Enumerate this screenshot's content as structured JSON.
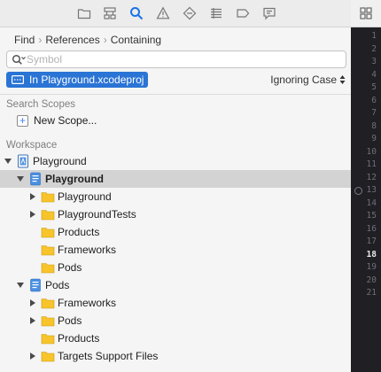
{
  "toolbar": {
    "icons": [
      "folder-icon",
      "hierarchy-icon",
      "search-icon",
      "warning-icon",
      "diamond-icon",
      "list-icon",
      "tag-icon",
      "comment-icon"
    ],
    "active": "search-icon"
  },
  "breadcrumb": [
    "Find",
    "References",
    "Containing"
  ],
  "search": {
    "placeholder": "Symbol",
    "value": ""
  },
  "scope_chip": {
    "label": "In Playground.xcodeproj"
  },
  "case_select": {
    "label": "Ignoring Case"
  },
  "search_scopes": {
    "title": "Search Scopes",
    "new_scope_label": "New Scope..."
  },
  "workspace": {
    "title": "Workspace",
    "rows": [
      {
        "label": "Playground",
        "icon": "workspace-icon",
        "disclosure": "expanded",
        "selected": false,
        "bold": false
      },
      {
        "label": "Playground",
        "icon": "project-icon",
        "disclosure": "expanded",
        "selected": true,
        "bold": true
      },
      {
        "label": "Playground",
        "icon": "folder-icon",
        "disclosure": "collapsed",
        "selected": false,
        "bold": false
      },
      {
        "label": "PlaygroundTests",
        "icon": "folder-icon",
        "disclosure": "collapsed",
        "selected": false,
        "bold": false
      },
      {
        "label": "Products",
        "icon": "folder-icon",
        "disclosure": "none",
        "selected": false,
        "bold": false
      },
      {
        "label": "Frameworks",
        "icon": "folder-icon",
        "disclosure": "none",
        "selected": false,
        "bold": false
      },
      {
        "label": "Pods",
        "icon": "folder-icon",
        "disclosure": "none",
        "selected": false,
        "bold": false
      },
      {
        "label": "Pods",
        "icon": "project-icon",
        "disclosure": "expanded",
        "selected": false,
        "bold": false
      },
      {
        "label": "Frameworks",
        "icon": "folder-icon",
        "disclosure": "collapsed",
        "selected": false,
        "bold": false
      },
      {
        "label": "Pods",
        "icon": "folder-icon",
        "disclosure": "collapsed",
        "selected": false,
        "bold": false
      },
      {
        "label": "Products",
        "icon": "folder-icon",
        "disclosure": "none",
        "selected": false,
        "bold": false
      },
      {
        "label": "Targets Support Files",
        "icon": "folder-icon",
        "disclosure": "collapsed",
        "selected": false,
        "bold": false
      }
    ]
  },
  "editor": {
    "line_numbers": [
      "1",
      "2",
      "3",
      "4",
      "5",
      "6",
      "7",
      "8",
      "9",
      "10",
      "11",
      "12",
      "13",
      "14",
      "15",
      "16",
      "17",
      "18",
      "19",
      "20",
      "21"
    ],
    "current_line": "18",
    "marker_line": "13"
  },
  "colors": {
    "accent": "#2a74d5",
    "folder": "#f7c42b",
    "selected_row": "#d3d3d3",
    "editor_bg": "#1f1f24"
  }
}
